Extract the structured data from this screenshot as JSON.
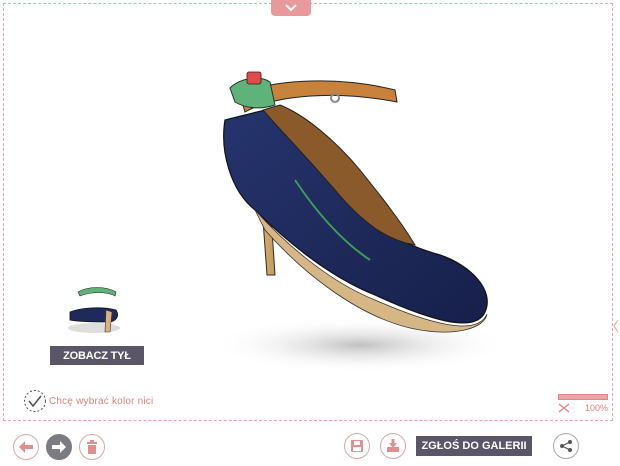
{
  "colors": {
    "accent": "#e89a9a",
    "dark_button": "#5a5667",
    "shoe_upper": "#1f2a5c",
    "strap_green": "#5fb27a",
    "heel_wood": "#d8b27a"
  },
  "preview": {
    "back_view_button": "ZOBACZ TYŁ"
  },
  "thread_option": {
    "label": "Chcę wybrać kolor nici"
  },
  "zoom": {
    "value": "100%",
    "level": 1.0
  },
  "toolbar": {
    "gallery_button": "ZGŁOŚ DO GALERII"
  },
  "icons": {
    "top_toggle": "chevron-down-icon",
    "undo": "arrow-left-icon",
    "redo": "arrow-right-icon",
    "delete": "trash-icon",
    "save": "save-icon",
    "download": "download-icon",
    "share": "share-icon",
    "zoom": "scissors-icon",
    "thread": "check-icon"
  }
}
